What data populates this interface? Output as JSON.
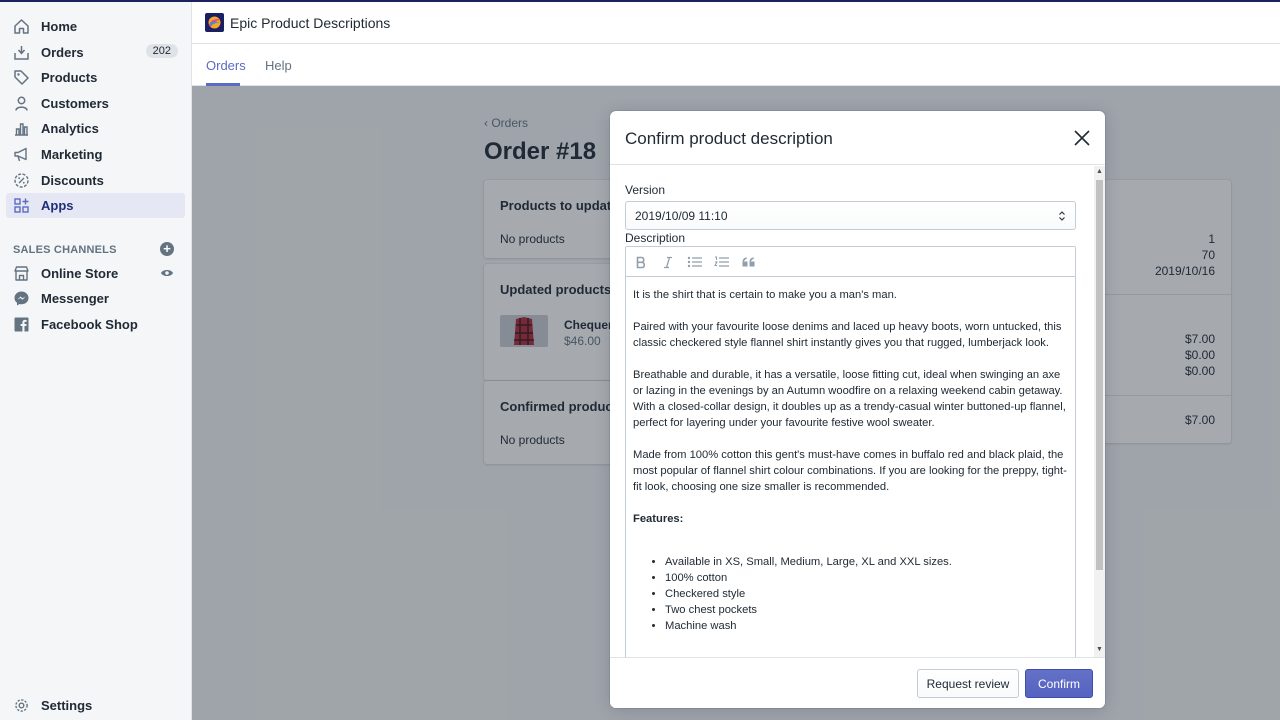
{
  "sidebar": {
    "items": [
      {
        "label": "Home",
        "icon": "home-icon"
      },
      {
        "label": "Orders",
        "icon": "orders-icon",
        "badge": "202"
      },
      {
        "label": "Products",
        "icon": "tag-icon"
      },
      {
        "label": "Customers",
        "icon": "person-icon"
      },
      {
        "label": "Analytics",
        "icon": "bar-chart-icon"
      },
      {
        "label": "Marketing",
        "icon": "megaphone-icon"
      },
      {
        "label": "Discounts",
        "icon": "discount-icon"
      },
      {
        "label": "Apps",
        "icon": "apps-icon",
        "active": true
      }
    ],
    "sales_channels_heading": "SALES CHANNELS",
    "channels": [
      {
        "label": "Online Store",
        "icon": "store-icon"
      },
      {
        "label": "Messenger",
        "icon": "messenger-icon"
      },
      {
        "label": "Facebook Shop",
        "icon": "facebook-icon"
      }
    ],
    "settings_label": "Settings"
  },
  "header": {
    "app_title": "Epic Product Descriptions",
    "tabs": [
      {
        "label": "Orders",
        "active": true
      },
      {
        "label": "Help"
      }
    ]
  },
  "page": {
    "breadcrumb": "Orders",
    "title": "Order #18",
    "cards": {
      "products_to_update": {
        "title": "Products to update",
        "empty": "No products"
      },
      "updated_products": {
        "title": "Updated products",
        "product_name": "Chequere",
        "product_price": "$46.00"
      },
      "confirmed_products": {
        "title": "Confirmed product",
        "empty": "No products"
      }
    },
    "side_values": [
      "1",
      "70",
      "2019/10/16",
      "$7.00",
      "$0.00",
      "$0.00",
      "$7.00"
    ]
  },
  "modal": {
    "title": "Confirm product description",
    "version_label": "Version",
    "version_value": "2019/10/09 11:10",
    "description_label": "Description",
    "paragraphs": [
      "It is the shirt that is certain to make you a man's man.",
      "Paired with your favourite loose denims and laced up heavy boots, worn untucked, this classic checkered style flannel shirt instantly gives you that rugged, lumberjack look.",
      "Breathable and durable, it has a versatile, loose fitting cut, ideal when swinging an axe or lazing in the evenings by an Autumn woodfire on a relaxing weekend cabin getaway. With a closed-collar design, it doubles up as a trendy-casual winter buttoned-up flannel, perfect for layering under your favourite festive wool sweater.",
      "Made from 100% cotton this gent's must-have comes in buffalo red and black plaid, the most popular of flannel shirt colour combinations. If you are looking for the preppy, tight-fit look, choosing one size smaller is recommended."
    ],
    "features_heading": "Features:",
    "features": [
      "Available in XS, Small, Medium, Large, XL and XXL sizes.",
      "100% cotton",
      "Checkered style",
      "Two chest pockets",
      "Machine wash"
    ],
    "request_review_label": "Request review",
    "confirm_label": "Confirm"
  },
  "colors": {
    "accent": "#5c6ac4",
    "sidebar_active_bg": "#e5e8f4",
    "primary_button": "#5c6ac4"
  }
}
